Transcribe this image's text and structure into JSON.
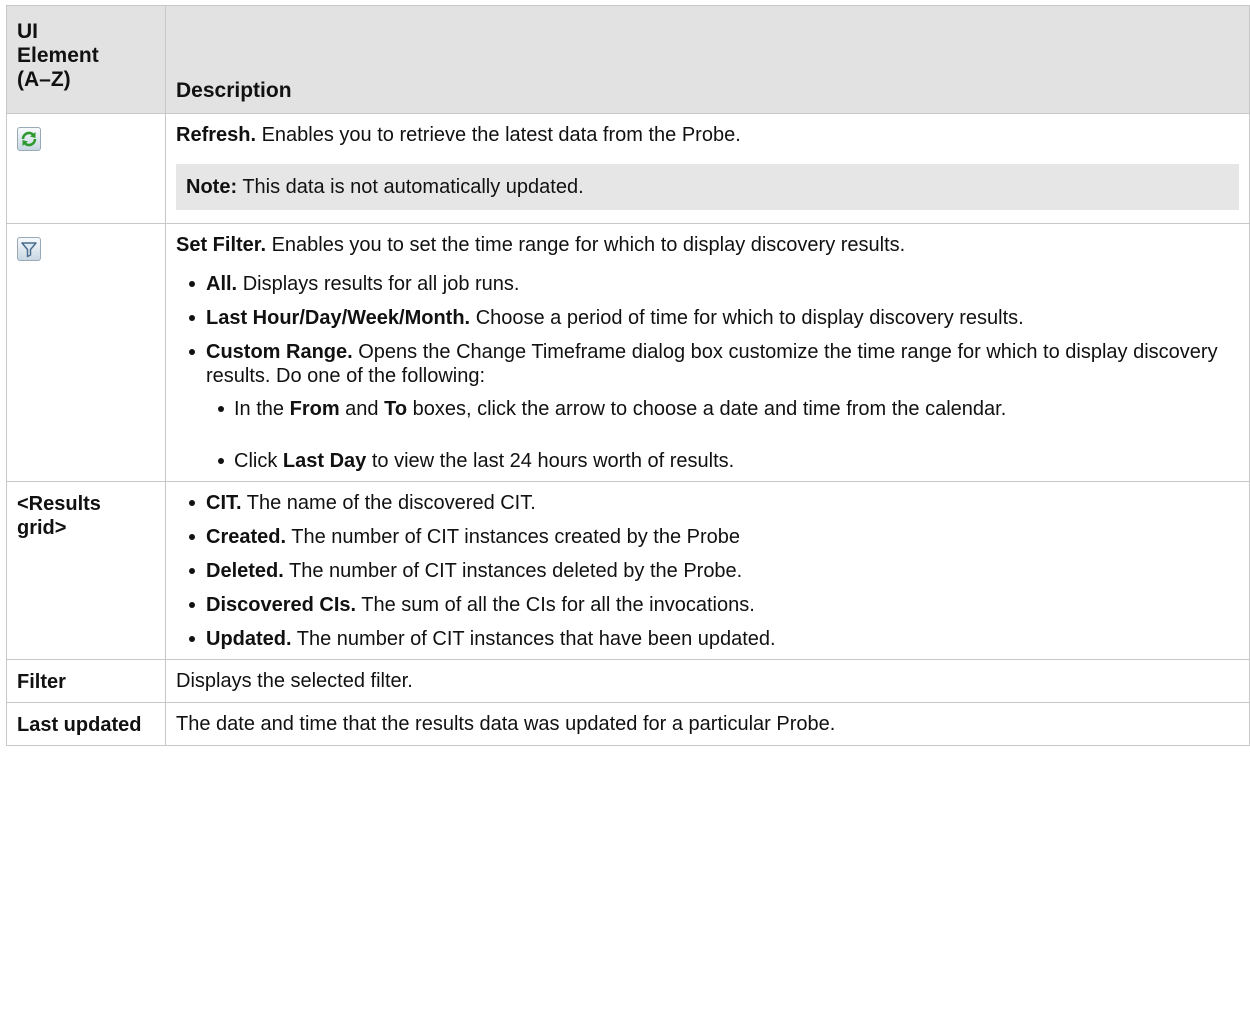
{
  "header": {
    "col1": "UI Element (A–Z)",
    "col1_lines": [
      "UI",
      "Element",
      "(A–Z)"
    ],
    "col2": "Description"
  },
  "rows": [
    {
      "icon": "refresh-icon",
      "title": "Refresh.",
      "text": "Enables you to retrieve the latest data from the Probe.",
      "note_label": "Note:",
      "note_text": "This data is not automatically updated."
    },
    {
      "icon": "filter-icon",
      "title": "Set Filter.",
      "text": "Enables you to set the time range for which to display discovery results.",
      "items": [
        {
          "label": "All.",
          "text": "Displays results for all job runs."
        },
        {
          "label": "Last Hour/Day/Week/Month.",
          "text": "Choose a period of time for which to display discovery results."
        },
        {
          "label": "Custom Range.",
          "text": "Opens the Change Timeframe dialog box customize the time range for which to display discovery results. Do one of the following:"
        }
      ],
      "subitems": [
        {
          "pre": "In the",
          "b1": "From",
          "mid": "and",
          "b2": "To",
          "post": "boxes, click the arrow to choose a date and time from the calendar."
        },
        {
          "pre": "Click",
          "b1": "Last Day",
          "post": "to view the last 24 hours worth of results."
        }
      ]
    },
    {
      "element": "<Results grid>",
      "items": [
        {
          "label": "CIT.",
          "text": "The name of the discovered CIT."
        },
        {
          "label": "Created.",
          "text": "The number of CIT instances created by the Probe"
        },
        {
          "label": "Deleted.",
          "text": "The number of CIT instances deleted by the Probe."
        },
        {
          "label": "Discovered CIs.",
          "text": "The sum of all the CIs for all the invocations."
        },
        {
          "label": "Updated.",
          "text": "The number of CIT instances that have been updated."
        }
      ]
    },
    {
      "element": "Filter",
      "text": "Displays the selected filter."
    },
    {
      "element": "Last updated",
      "text": "The date and time that the results data was updated for a particular Probe."
    }
  ],
  "colors": {
    "header_bg": "#e2e2e2",
    "note_bg": "#e6e6e6",
    "border": "#c8c8c8"
  }
}
